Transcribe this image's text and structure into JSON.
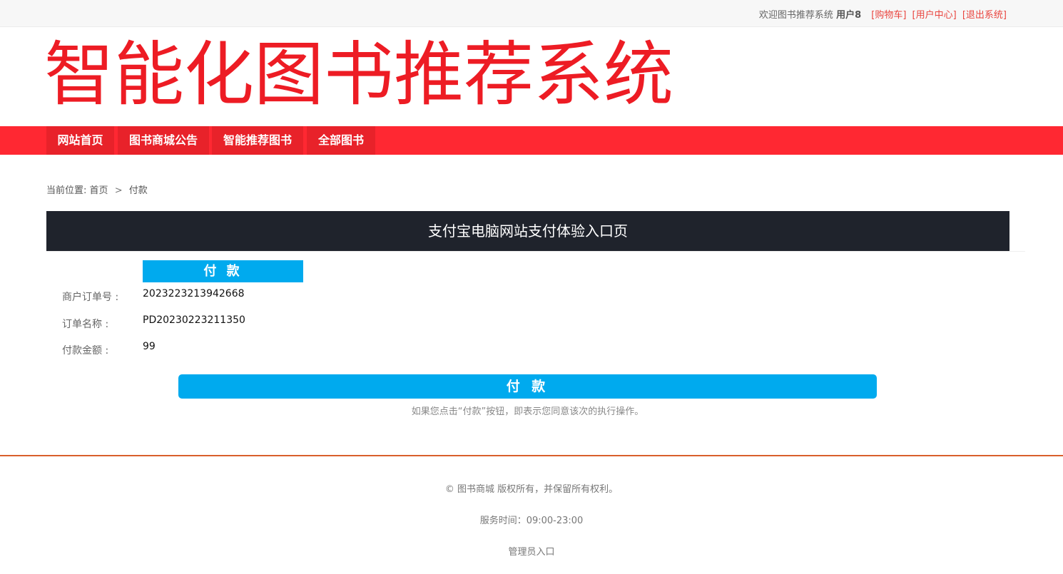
{
  "topbar": {
    "welcome": "欢迎图书推荐系统",
    "user": "用户8",
    "cart": "[购物车]",
    "user_center": "[用户中心]",
    "logout": "[退出系统]"
  },
  "logo": {
    "text": "智能化图书推荐系统"
  },
  "nav": {
    "items": [
      {
        "label": "网站首页"
      },
      {
        "label": "图书商城公告"
      },
      {
        "label": "智能推荐图书"
      },
      {
        "label": "全部图书"
      }
    ]
  },
  "breadcrumb": {
    "prefix": "当前位置:",
    "home": "首页",
    "separator": ">",
    "current": "付款"
  },
  "payment": {
    "header": "支付宝电脑网站支付体验入口页",
    "tab_label": "付 款",
    "fields": [
      {
        "label": "商户订单号 :",
        "value": "2023223213942668"
      },
      {
        "label": "订单名称 :",
        "value": "PD20230223211350"
      },
      {
        "label": "付款金额 :",
        "value": "99"
      }
    ],
    "button_label": "付 款",
    "note": "如果您点击“付款”按钮，即表示您同意该次的执行操作。"
  },
  "footer": {
    "copyright": "© 图书商城 版权所有，并保留所有权利。",
    "service_hours": "服务时间：09:00-23:00",
    "admin_link": "管理员入口"
  },
  "colors": {
    "brand_red": "#ed1c24",
    "nav_red": "#ff2832",
    "pay_blue": "#00aaee",
    "header_dark": "#1f232c",
    "footer_line": "#d95f2b"
  }
}
